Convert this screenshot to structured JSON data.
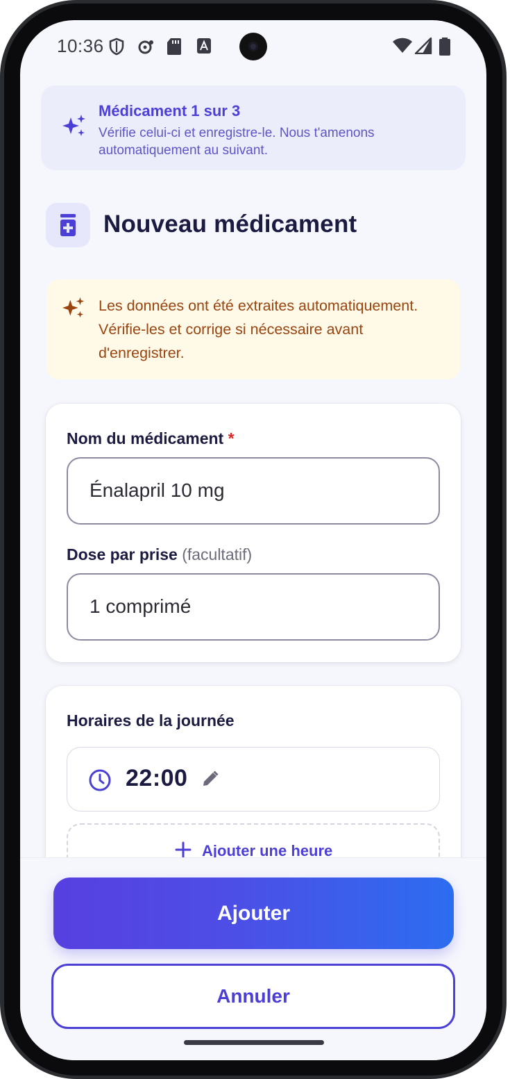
{
  "status_bar": {
    "time": "10:36"
  },
  "progress_banner": {
    "title": "Médicament 1 sur 3",
    "subtitle": "Vérifie celui-ci et enregistre-le. Nous t'amenons automatiquement au suivant."
  },
  "header": {
    "title": "Nouveau médicament"
  },
  "ai_notice": {
    "text": "Les données ont été extraites automatiquement. Vérifie-les et corrige si nécessaire avant d'enregistrer."
  },
  "medication_form": {
    "name_label": "Nom du médicament",
    "name_required_marker": "*",
    "name_value": "Énalapril 10 mg",
    "dose_label": "Dose par prise",
    "dose_optional": "(facultatif)",
    "dose_value": "1 comprimé"
  },
  "schedule": {
    "label": "Horaires de la journée",
    "times": [
      "22:00"
    ],
    "add_time_label": "Ajouter une heure"
  },
  "actions": {
    "primary_label": "Ajouter",
    "secondary_label": "Annuler"
  },
  "colors": {
    "accent": "#4b3fd6",
    "title": "#1b1a40",
    "warning_text": "#9a4410",
    "warning_bg": "#fff9e8",
    "required": "#d62a2a"
  }
}
